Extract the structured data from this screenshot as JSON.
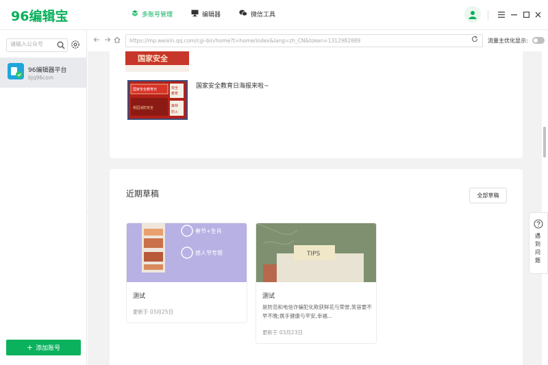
{
  "app": {
    "logo": "96编辑宝",
    "accent": "#07b05a"
  },
  "nav": [
    {
      "label": "多账号管理",
      "icon": "layers-icon",
      "active": true
    },
    {
      "label": "编辑器",
      "icon": "monitor-icon",
      "active": false
    },
    {
      "label": "微信工具",
      "icon": "wechat-icon",
      "active": false
    }
  ],
  "window_controls": [
    "menu-icon",
    "minimize-icon",
    "maximize-icon",
    "close-icon"
  ],
  "sidebar": {
    "search_placeholder": "请输入公众号",
    "account": {
      "name": "96编辑器平台",
      "id": "bjq96com"
    },
    "add_button": "添加账号"
  },
  "browser": {
    "url": "https://mp.weixin.qq.com/cgi-bin/home?t=home/index&lang=zh_CN&token=1312982889",
    "flow_label": "流量主优化显示:",
    "flow_toggle_on": false
  },
  "article": {
    "title": "国家安全教育日海报来啦~",
    "thumb1_text": "国家安全",
    "thumb2_labels": [
      "国家安全教育日",
      "校园消防安全",
      "安全",
      "教育",
      "森林",
      "防火"
    ]
  },
  "drafts_section": {
    "title": "近期草稿",
    "all_button": "全部草稿",
    "items": [
      {
        "title": "测试",
        "desc": "",
        "date": "更新于 03月25日",
        "cover_texts": [
          "春节+生肖",
          "感人节专题"
        ]
      },
      {
        "title": "测试",
        "desc": "是防范和电信诈骗犯化欺获鲜花与荣誉,笑容要不早不晚;携手健康与平安,幸福...",
        "date": "更新于 03月23日",
        "cover_texts": [
          "TIPS"
        ]
      }
    ]
  },
  "help": {
    "label": "遇到问题"
  }
}
